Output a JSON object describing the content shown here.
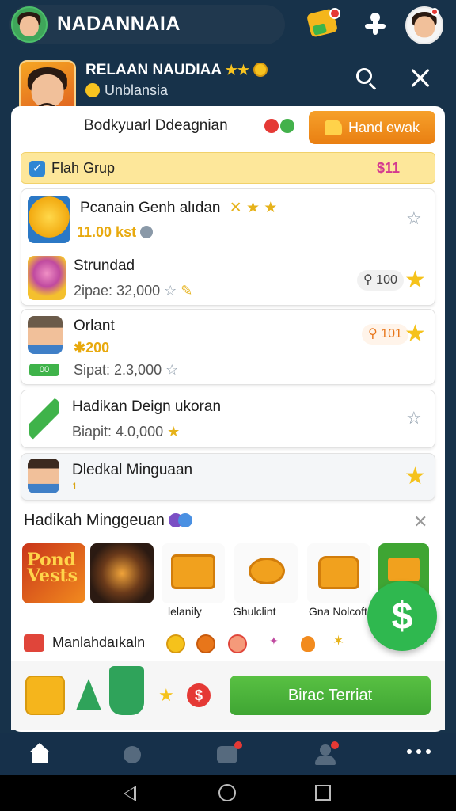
{
  "topbar": {
    "title": "NADANNAIA"
  },
  "banner": {
    "name": "RELAAN NAUDIAA",
    "stars": "★★",
    "subtitle": "Unblansia"
  },
  "sheet": {
    "title": "Bodkyuarl Ddeagnian",
    "hand_button": "Hand ewak",
    "group": {
      "label": "Flah Grup",
      "count": "$11"
    }
  },
  "items": [
    {
      "title": "Pcanain Genh alıdan",
      "value": "11.00 kst",
      "badge": "✕ ★ ★"
    },
    {
      "title": "Strundad",
      "meta": "2ipae: 32,000",
      "count": "100"
    },
    {
      "title": "Orlant",
      "value": "200",
      "meta": "Sipat: 2.3,000",
      "count": "101",
      "tag": "00"
    },
    {
      "title": "Hadikan Deign ukoran",
      "meta": "Biapit: 4.0,000"
    },
    {
      "title": "Dledkal Minguaan",
      "meta": "1"
    }
  ],
  "weekly": {
    "title": "Hadikah Minggeuan",
    "tiles": [
      {
        "label": "",
        "art": "Pond Vests"
      },
      {
        "label": ""
      },
      {
        "label": "lelanily"
      },
      {
        "label": "Ghulclint"
      },
      {
        "label": "Gna Nolcoft"
      },
      {
        "label": ""
      }
    ]
  },
  "rewards": {
    "label": "Manlahdaıkaln"
  },
  "bottom": {
    "start_button": "Birac Terriat"
  },
  "fab": {
    "symbol": "$"
  },
  "colors": {
    "background": "#17324a",
    "accent_green": "#3fa533",
    "accent_orange": "#e97f12",
    "gold": "#f5c21b",
    "group_bar": "#fde79a",
    "group_count": "#d43a8f"
  }
}
